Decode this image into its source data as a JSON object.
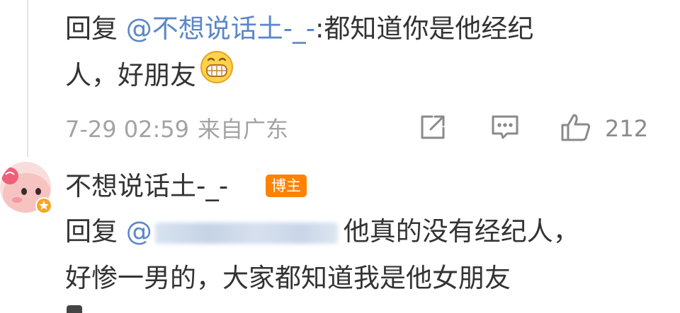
{
  "comment1": {
    "prefix": "回复",
    "mention": "@不想说话土-_-",
    "text": ":都知道你是他经纪",
    "text_line2": "人，好朋友",
    "emoji": "grin-emoji",
    "date": "7-29 02:59",
    "location": "来自广东",
    "like_count": "212"
  },
  "comment2": {
    "username": "不想说话土-_-",
    "badge": "博主",
    "prefix": "回复",
    "mention": "@",
    "text": "他真的没有经纪人，",
    "text_line2": "好惨一男的，大家都知道我是他女朋友"
  },
  "icons": {
    "share": "share-icon",
    "comment": "comment-icon",
    "like": "thumbs-up-icon",
    "avatar_badge": "star-badge-icon"
  },
  "colors": {
    "mention": "#5b87c7",
    "text": "#333333",
    "meta": "#a3a3a3",
    "badge": "#ff8200"
  }
}
